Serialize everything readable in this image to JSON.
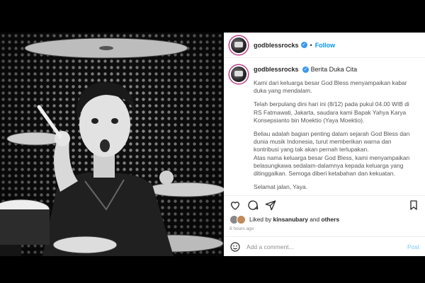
{
  "header": {
    "username": "godblessrocks",
    "separator": "•",
    "follow_label": "Follow"
  },
  "caption": {
    "username": "godblessrocks",
    "title": "Berita Duka Cita",
    "paragraphs": [
      "Kami dari keluarga besar God Bless menyampaikan kabar duka yang mendalam.",
      "Telah berpulang dini hari ini (8/12) pada pukul 04.00 WIB di RS Fatmawati, Jakarta, saudara kami Bapak Yahya Karya Konsepsianto bin Moektio (Yaya Moektio).",
      "Beliau adalah bagian penting dalam sejarah God Bless dan dunia musik Indonesia, turut memberikan warna dan kontribusi yang tak akan pernah terlupakan.",
      "Atas nama keluarga besar God Bless, kami menyampaikan belasungkawa sedalam-dalamnya kepada keluarga yang ditinggalkan. Semoga diberi ketabahan dan kekuatan.",
      "Selamat jalan, Yaya."
    ]
  },
  "likes": {
    "prefix": "Liked by",
    "user": "kinsanubary",
    "joiner": "and",
    "others": "others"
  },
  "timestamp": "8 hours ago",
  "comment": {
    "placeholder": "Add a comment...",
    "post_label": "Post"
  },
  "colors": {
    "accent": "#0095f6",
    "verified": "#3897f0"
  }
}
